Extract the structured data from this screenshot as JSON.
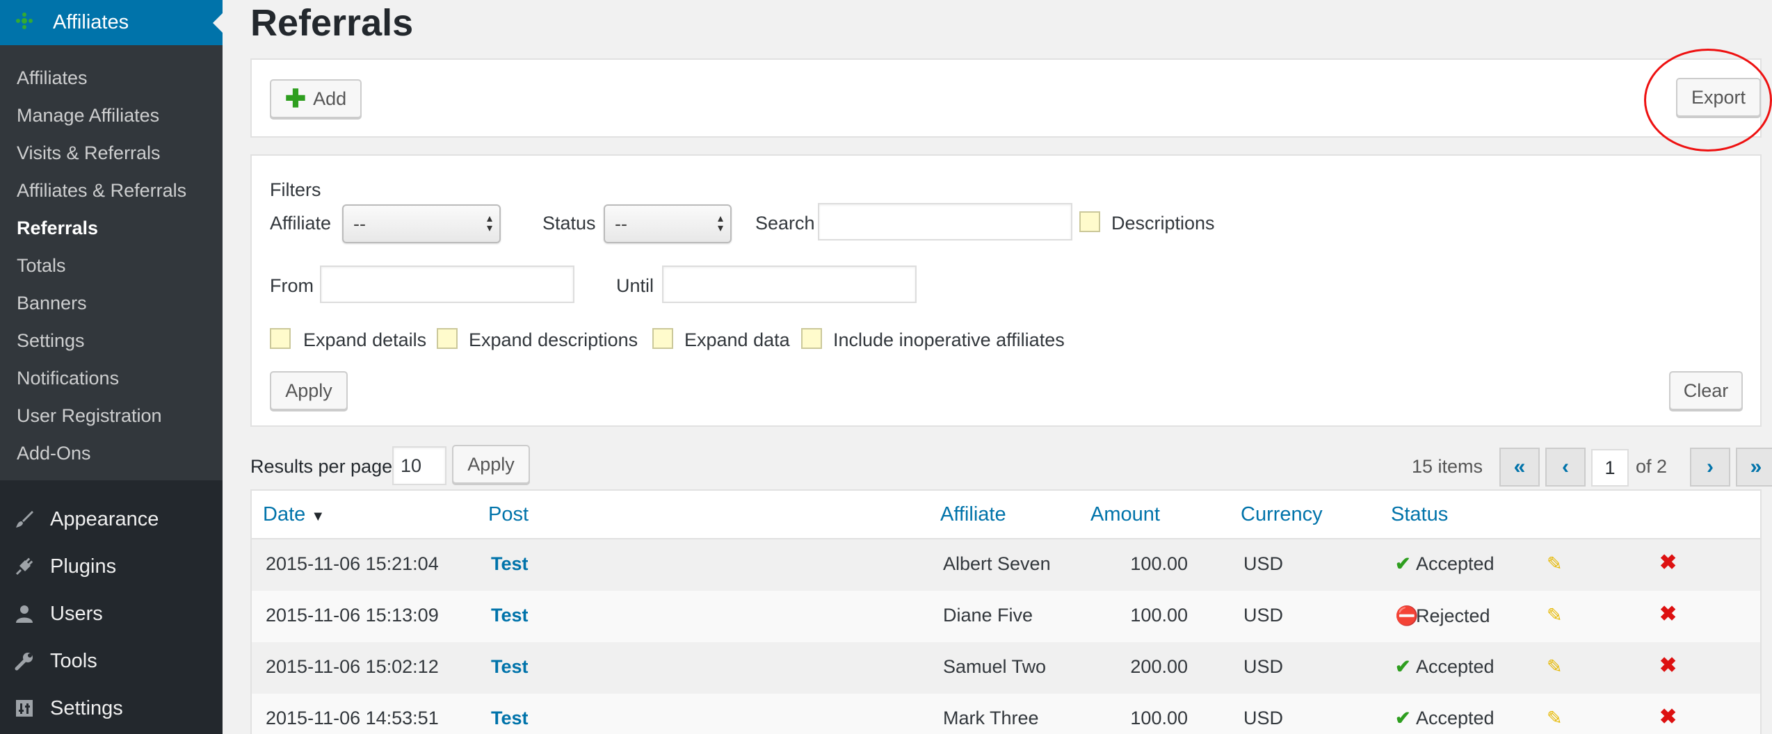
{
  "sidebar": {
    "header": "Affiliates",
    "submenu": [
      "Affiliates",
      "Manage Affiliates",
      "Visits & Referrals",
      "Affiliates & Referrals",
      "Referrals",
      "Totals",
      "Banners",
      "Settings",
      "Notifications",
      "User Registration",
      "Add-Ons"
    ],
    "current": "Referrals",
    "menu": [
      {
        "label": "Appearance",
        "icon": "paintbrush-icon"
      },
      {
        "label": "Plugins",
        "icon": "plug-icon"
      },
      {
        "label": "Users",
        "icon": "user-icon"
      },
      {
        "label": "Tools",
        "icon": "wrench-icon"
      },
      {
        "label": "Settings",
        "icon": "settings-icon"
      }
    ]
  },
  "page": {
    "title": "Referrals"
  },
  "actions": {
    "add_label": "Add",
    "export_label": "Export"
  },
  "filters": {
    "heading": "Filters",
    "affiliate_label": "Affiliate",
    "affiliate_value": "--",
    "status_label": "Status",
    "status_value": "--",
    "search_label": "Search",
    "search_value": "",
    "descriptions_label": "Descriptions",
    "from_label": "From",
    "from_value": "",
    "until_label": "Until",
    "until_value": "",
    "expand_details": "Expand details",
    "expand_descriptions": "Expand descriptions",
    "expand_data": "Expand data",
    "include_inoperative": "Include inoperative affiliates",
    "apply_label": "Apply",
    "clear_label": "Clear"
  },
  "pagination": {
    "rpp_label": "Results per page",
    "rpp_value": "10",
    "rpp_apply": "Apply",
    "items": "15 items",
    "first": "«",
    "prev": "‹",
    "current_page": "1",
    "of": "of 2",
    "next": "›",
    "last": "»"
  },
  "table": {
    "headers": {
      "date": "Date",
      "post": "Post",
      "affiliate": "Affiliate",
      "amount": "Amount",
      "currency": "Currency",
      "status": "Status"
    },
    "rows": [
      {
        "date": "2015-11-06 15:21:04",
        "post": "Test",
        "affiliate": "Albert Seven",
        "amount": "100.00",
        "currency": "USD",
        "status": "Accepted"
      },
      {
        "date": "2015-11-06 15:13:09",
        "post": "Test",
        "affiliate": "Diane Five",
        "amount": "100.00",
        "currency": "USD",
        "status": "Rejected"
      },
      {
        "date": "2015-11-06 15:02:12",
        "post": "Test",
        "affiliate": "Samuel Two",
        "amount": "200.00",
        "currency": "USD",
        "status": "Accepted"
      },
      {
        "date": "2015-11-06 14:53:51",
        "post": "Test",
        "affiliate": "Mark Three",
        "amount": "100.00",
        "currency": "USD",
        "status": "Accepted"
      }
    ]
  },
  "colors": {
    "accent": "#0073aa",
    "sidebar": "#23282d",
    "accepted": "#2e9e1f",
    "rejected": "#dd1111"
  }
}
